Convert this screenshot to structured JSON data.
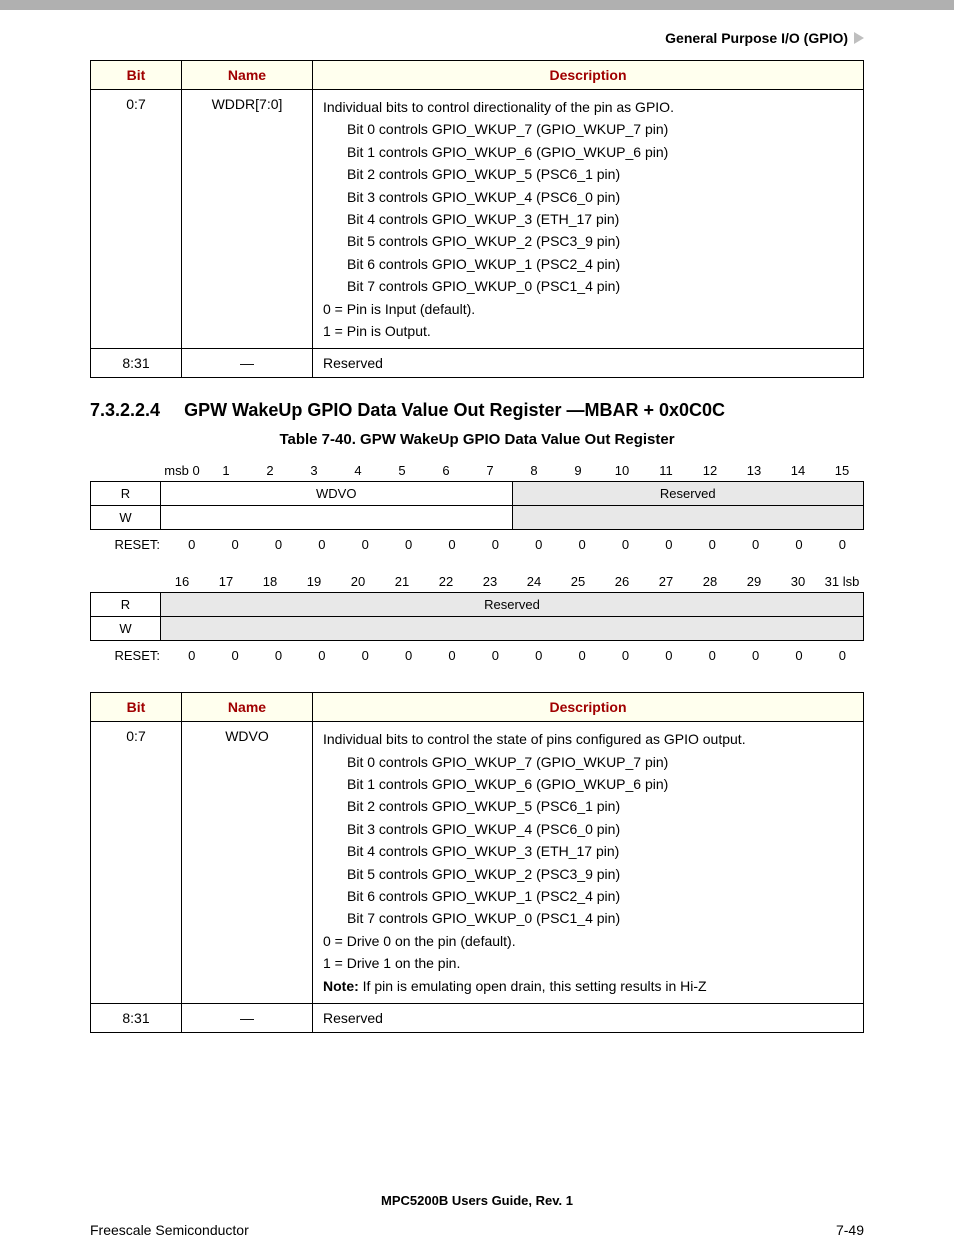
{
  "header": {
    "chapter": "General Purpose I/O (GPIO)"
  },
  "table1": {
    "headers": {
      "bit": "Bit",
      "name": "Name",
      "desc": "Description"
    },
    "rows": [
      {
        "bit": "0:7",
        "name": "WDDR[7:0]",
        "intro": "Individual bits to control directionality of the pin as GPIO.",
        "lines": [
          "Bit 0 controls GPIO_WKUP_7 (GPIO_WKUP_7 pin)",
          "Bit 1 controls GPIO_WKUP_6 (GPIO_WKUP_6 pin)",
          "Bit 2 controls GPIO_WKUP_5 (PSC6_1 pin)",
          "Bit 3 controls GPIO_WKUP_4 (PSC6_0 pin)",
          "Bit 4 controls GPIO_WKUP_3 (ETH_17 pin)",
          "Bit 5 controls GPIO_WKUP_2 (PSC3_9 pin)",
          "Bit 6 controls GPIO_WKUP_1 (PSC2_4 pin)",
          "Bit 7 controls GPIO_WKUP_0 (PSC1_4 pin)"
        ],
        "trail": [
          "0 = Pin is Input  (default).",
          "1 = Pin is Output."
        ]
      },
      {
        "bit": "8:31",
        "name": "—",
        "intro": "Reserved",
        "lines": [],
        "trail": []
      }
    ]
  },
  "section": {
    "num": "7.3.2.2.4",
    "title": "GPW WakeUp GPIO Data Value Out Register —MBAR + 0x0C0C"
  },
  "caption": "Table 7-40. GPW WakeUp GPIO Data Value Out Register",
  "reg": {
    "bits_hi": [
      "msb 0",
      "1",
      "2",
      "3",
      "4",
      "5",
      "6",
      "7",
      "8",
      "9",
      "10",
      "11",
      "12",
      "13",
      "14",
      "15"
    ],
    "bits_lo": [
      "16",
      "17",
      "18",
      "19",
      "20",
      "21",
      "22",
      "23",
      "24",
      "25",
      "26",
      "27",
      "28",
      "29",
      "30",
      "31 lsb"
    ],
    "rw_r": "R",
    "rw_w": "W",
    "reset_label": "RESET:",
    "seg_hi": [
      {
        "span": 8,
        "label": "WDVO",
        "reserved": false
      },
      {
        "span": 8,
        "label": "Reserved",
        "reserved": true
      }
    ],
    "seg_lo": [
      {
        "span": 16,
        "label": "Reserved",
        "reserved": true
      }
    ],
    "reset_hi": [
      "0",
      "0",
      "0",
      "0",
      "0",
      "0",
      "0",
      "0",
      "0",
      "0",
      "0",
      "0",
      "0",
      "0",
      "0",
      "0"
    ],
    "reset_lo": [
      "0",
      "0",
      "0",
      "0",
      "0",
      "0",
      "0",
      "0",
      "0",
      "0",
      "0",
      "0",
      "0",
      "0",
      "0",
      "0"
    ]
  },
  "table2": {
    "headers": {
      "bit": "Bit",
      "name": "Name",
      "desc": "Description"
    },
    "rows": [
      {
        "bit": "0:7",
        "name": "WDVO",
        "intro": "Individual bits to control the state of pins configured as GPIO output.",
        "lines": [
          "Bit 0 controls GPIO_WKUP_7 (GPIO_WKUP_7 pin)",
          "Bit 1 controls GPIO_WKUP_6 (GPIO_WKUP_6 pin)",
          "Bit 2 controls GPIO_WKUP_5 (PSC6_1 pin)",
          "Bit 3 controls GPIO_WKUP_4 (PSC6_0 pin)",
          "Bit 4 controls GPIO_WKUP_3 (ETH_17 pin)",
          "Bit 5 controls GPIO_WKUP_2 (PSC3_9 pin)",
          "Bit 6 controls GPIO_WKUP_1 (PSC2_4 pin)",
          "Bit 7 controls GPIO_WKUP_0 (PSC1_4 pin)"
        ],
        "trail": [
          "0 = Drive 0 on the pin (default).",
          "1 = Drive 1 on the pin."
        ],
        "note_label": "Note:",
        "note_text": "  If pin is emulating open drain, this setting results in Hi-Z"
      },
      {
        "bit": "8:31",
        "name": "—",
        "intro": "Reserved",
        "lines": [],
        "trail": []
      }
    ]
  },
  "footer": {
    "center": "MPC5200B Users Guide, Rev. 1",
    "left": "Freescale Semiconductor",
    "right": "7-49"
  }
}
